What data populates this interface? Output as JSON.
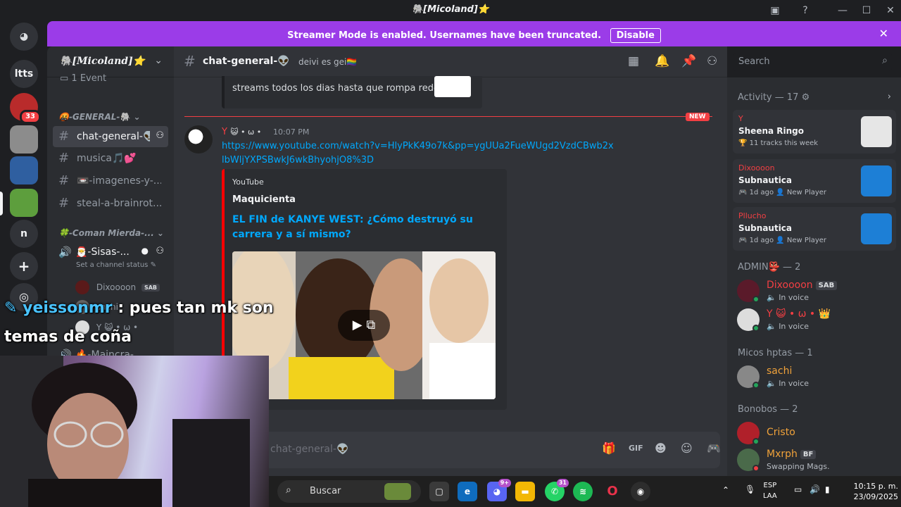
{
  "window": {
    "title": "🐘[Micoland]⭐"
  },
  "banner": {
    "message": "Streamer Mode is enabled. Usernames have been truncated.",
    "disable_label": "Disable"
  },
  "servers": [
    {
      "label": "ltts"
    },
    {
      "badge": "33"
    },
    {
      "label": "n"
    }
  ],
  "guild": {
    "name": "🐘[Micoland]⭐",
    "event_label": "1 Event"
  },
  "sidebar": {
    "category1": "🤬-GENERAL-🐘",
    "channels": [
      {
        "label": "chat-general-👽"
      },
      {
        "label": "musica🎵💕"
      },
      {
        "label": "📼-imagenes-y-..."
      },
      {
        "label": "steal-a-brainrot..."
      }
    ],
    "category2": "🍀-Coman Mierda-...",
    "voice_channel": "🎅-Sisas-...",
    "voice_status": "Set a channel status",
    "voice_users": [
      {
        "name": "Dixoooon",
        "tag": "SAB"
      },
      {
        "name": "sachi"
      },
      {
        "name": "Y 😺 • ω •"
      }
    ],
    "voice_channel2": "🔥-Maincra-"
  },
  "chat": {
    "channel_name": "chat-general-👽",
    "topic": "deivi es gei🏳️‍🌈",
    "prev_embed_text": "streams todos los dias hasta que rompa redes",
    "new_label": "NEW",
    "message": {
      "author": "Y",
      "author_nick": "😺 • ω •",
      "time": "10:07 PM",
      "link": "https://www.youtube.com/watch?v=HlyPkK49o7k&pp=ygUUa2FueWUgd2VzdCBwb2xlbWljYXPSBwkJ6wkBhyohjO8%3D"
    },
    "embed": {
      "provider": "YouTube",
      "author": "Maquicienta",
      "title": "EL FIN de KANYE WEST: ¿Cómo destruyó su carrera y a sí mismo?"
    },
    "composer_placeholder": "chat-general-👽"
  },
  "search": {
    "placeholder": "Search"
  },
  "activity": {
    "header": "Activity — 17",
    "cards": [
      {
        "user": "Y",
        "title": "Sheena Ringo",
        "sub": "🏆 11 tracks this week"
      },
      {
        "user": "Dixoooon",
        "title": "Subnautica",
        "sub": "🎮 1d ago  👤 New Player"
      },
      {
        "user": "Pllucho",
        "title": "Subnautica",
        "sub": "🎮 1d ago  👤 New Player"
      }
    ]
  },
  "members": {
    "admin_header": "ADMIN👺 — 2",
    "admins": [
      {
        "name": "Dixoooon",
        "tag": "SAB",
        "status": "🔈 In voice"
      },
      {
        "name": "Y 😺 • ω •",
        "tag": "👑",
        "status": "🔈 In voice"
      }
    ],
    "micos_header": "Micos hptas — 1",
    "micos": [
      {
        "name": "sachi",
        "status": "🔈 In voice"
      }
    ],
    "bonobos_header": "Bonobos — 2",
    "bonobos": [
      {
        "name": "Cristo",
        "status": ""
      },
      {
        "name": "Mxrph",
        "tag": "BF",
        "status": "Swapping Mags."
      }
    ]
  },
  "overlay": {
    "username": "yeissonmr",
    "line1": " : pues tan mk son",
    "line2": "temas de coña"
  },
  "taskbar": {
    "search_label": "Buscar",
    "whatsapp_badge": "31",
    "discord_badge": "9+",
    "lang_line1": "ESP",
    "lang_line2": "LAA",
    "time": "10:15 p. m.",
    "date": "23/09/2025"
  },
  "colors": {
    "banner": "#9b3ce8",
    "accent_red": "#f23f43",
    "link": "#00a8fc",
    "online": "#23a55a"
  }
}
